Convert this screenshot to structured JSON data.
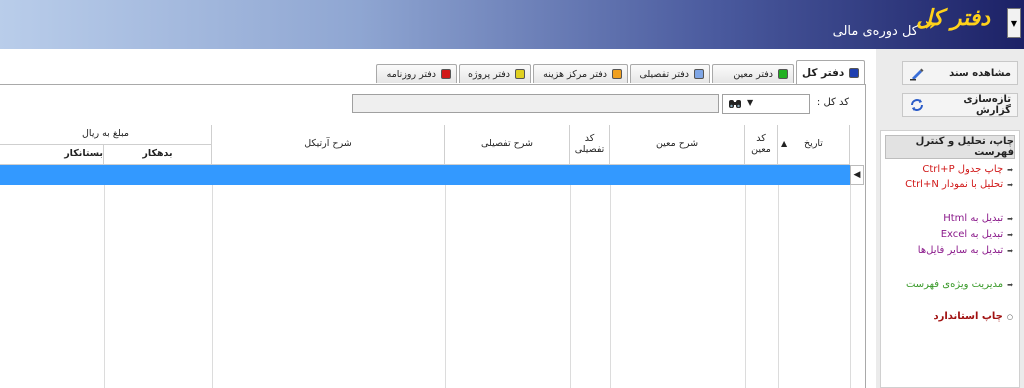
{
  "header": {
    "title": "دفتر کل",
    "subtitle": "کل دوره‌ی مالی",
    "arrows": "»",
    "dropdown_glyph": "▼"
  },
  "side_buttons": {
    "view_document": "مشاهده سند",
    "refresh_report": "تازه‌سازی گزارش"
  },
  "menu": {
    "heading": "چاپ، تحلیل و کنترل فهرست",
    "items": [
      {
        "label": "چاپ جدول  Ctrl+P",
        "color": "#d11a1a"
      },
      {
        "label": "تحلیل با نمودار  Ctrl+N",
        "color": "#d11a1a"
      },
      {
        "label": "تبدیل به Html",
        "color": "#8b1a8b"
      },
      {
        "label": "تبدیل به Excel",
        "color": "#8b1a8b"
      },
      {
        "label": "تبدیل به سایر فایل‌ها",
        "color": "#8b1a8b"
      },
      {
        "label": "مدیریت ویژه‌ی فهرست",
        "color": "#3a9a2a"
      },
      {
        "label": "چاپ استاندارد",
        "color": "#a01010"
      }
    ]
  },
  "tabs": [
    {
      "label": "دفتر کل",
      "color": "#1f3fb0",
      "active": true
    },
    {
      "label": "دفتر معین",
      "color": "#22b022"
    },
    {
      "label": "دفتر تفصیلی",
      "color": "#7fa6e6"
    },
    {
      "label": "دفتر مرکز هزینه",
      "color": "#f0a020"
    },
    {
      "label": "دفتر پروژه",
      "color": "#e0d020"
    },
    {
      "label": "دفتر روزنامه",
      "color": "#d01818"
    }
  ],
  "filter": {
    "label": "کد کل :",
    "combo_glyph": "▼",
    "search_value": ""
  },
  "grid": {
    "columns": {
      "date": "تاریخ",
      "moein_code": "کد\nمعین",
      "moein_desc": "شرح معین",
      "tafsili_code": "کد\nتفصیلی",
      "tafsili_desc": "شرح تفصیلی",
      "article_desc": "شرح آرتیکل",
      "amount_group": "مبلغ به ریال",
      "debit": "بدهکار",
      "credit": "بستانکار"
    },
    "sort_glyph": "▲",
    "row_indicator": "◀",
    "rows": []
  },
  "colors": {
    "selection": "#3399ff",
    "banner_dark": "#1c2166",
    "banner_light": "#b9cdea",
    "title_gold": "#ffd21a"
  }
}
